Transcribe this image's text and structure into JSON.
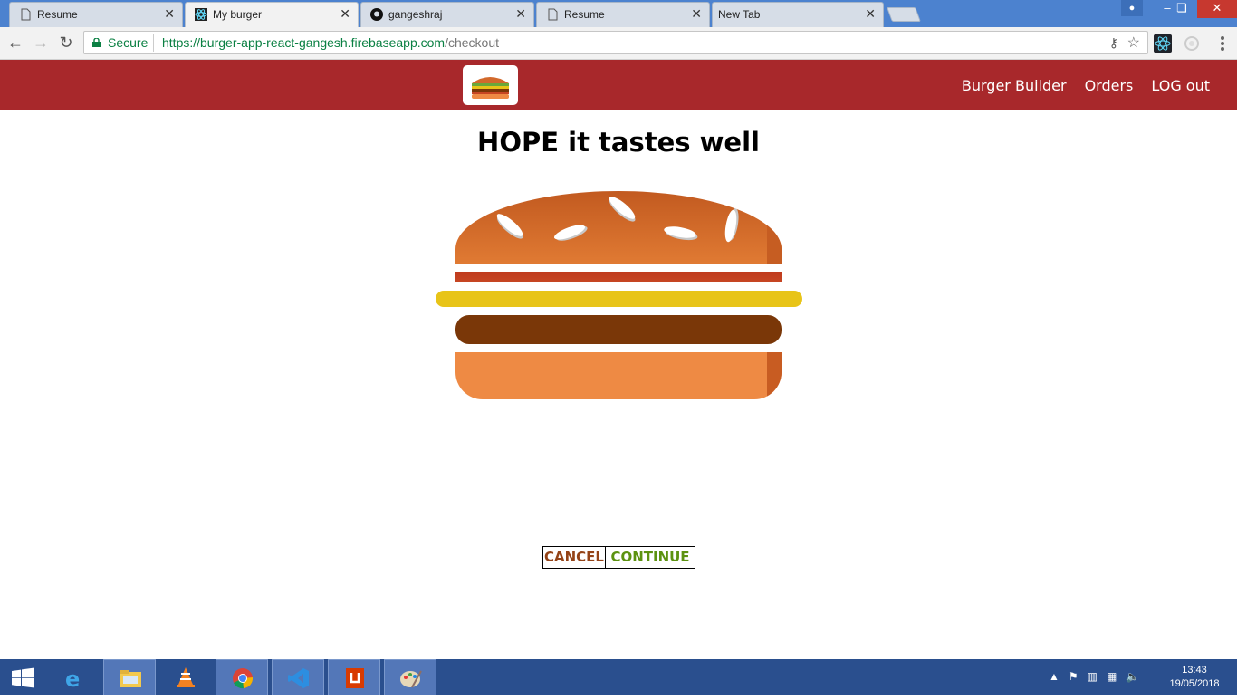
{
  "browser": {
    "tabs": [
      {
        "title": "Resume",
        "icon": "page-icon"
      },
      {
        "title": "My burger",
        "icon": "react-icon"
      },
      {
        "title": "gangeshraj",
        "icon": "github-icon"
      },
      {
        "title": "Resume",
        "icon": "page-icon"
      },
      {
        "title": "New Tab",
        "icon": ""
      }
    ],
    "tab_close": "✕",
    "secure_label": "Secure",
    "url_host": "https://burger-app-react-gangesh.firebaseapp.com",
    "url_path": "/checkout"
  },
  "app": {
    "nav": {
      "burger_builder": "Burger Builder",
      "orders": "Orders",
      "logout": "LOG out"
    },
    "heading": "HOPE it tastes well",
    "buttons": {
      "cancel": "CANCEL",
      "continue": "CONTINUE"
    },
    "colors": {
      "header": "#a8282b",
      "cancel": "#944317",
      "continue": "#5c9210"
    },
    "burger_layers": [
      "bread-top",
      "bacon",
      "cheese",
      "meat",
      "bread-bottom"
    ]
  },
  "taskbar": {
    "apps": [
      "internet-explorer",
      "file-explorer",
      "vlc",
      "chrome",
      "vscode",
      "office-upload",
      "paint"
    ],
    "time": "13:43",
    "date": "19/05/2018"
  }
}
